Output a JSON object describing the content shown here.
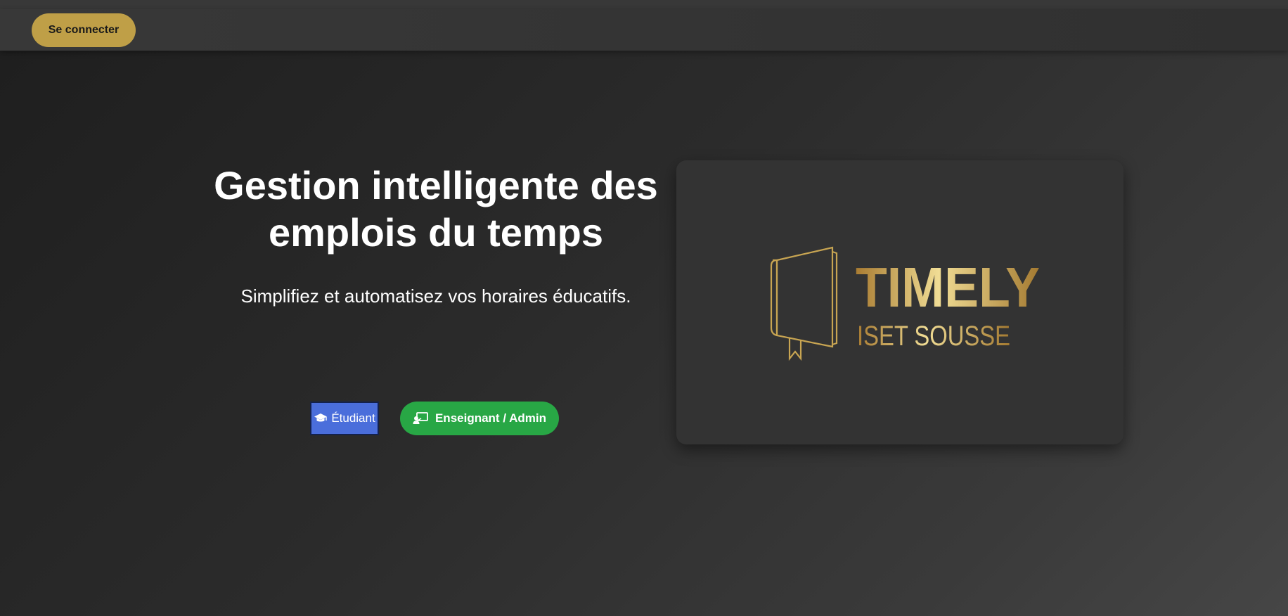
{
  "navbar": {
    "login_label": "Se connecter"
  },
  "hero": {
    "title": "Gestion intelligente des emplois du temps",
    "subtitle": "Simplifiez et automatisez vos horaires éducatifs.",
    "student_label": "Étudiant",
    "teacher_label": "Enseignant / Admin"
  },
  "logo": {
    "brand": "TIMELY",
    "tagline": "ISET SOUSSE"
  },
  "icons": {
    "student": "graduation-cap-icon",
    "teacher": "chalkboard-teacher-icon",
    "logo": "book-icon"
  },
  "colors": {
    "login_button": "#bf9f47",
    "student_button": "#4a6edb",
    "teacher_button": "#28a745",
    "gold": "#d9b65a"
  }
}
